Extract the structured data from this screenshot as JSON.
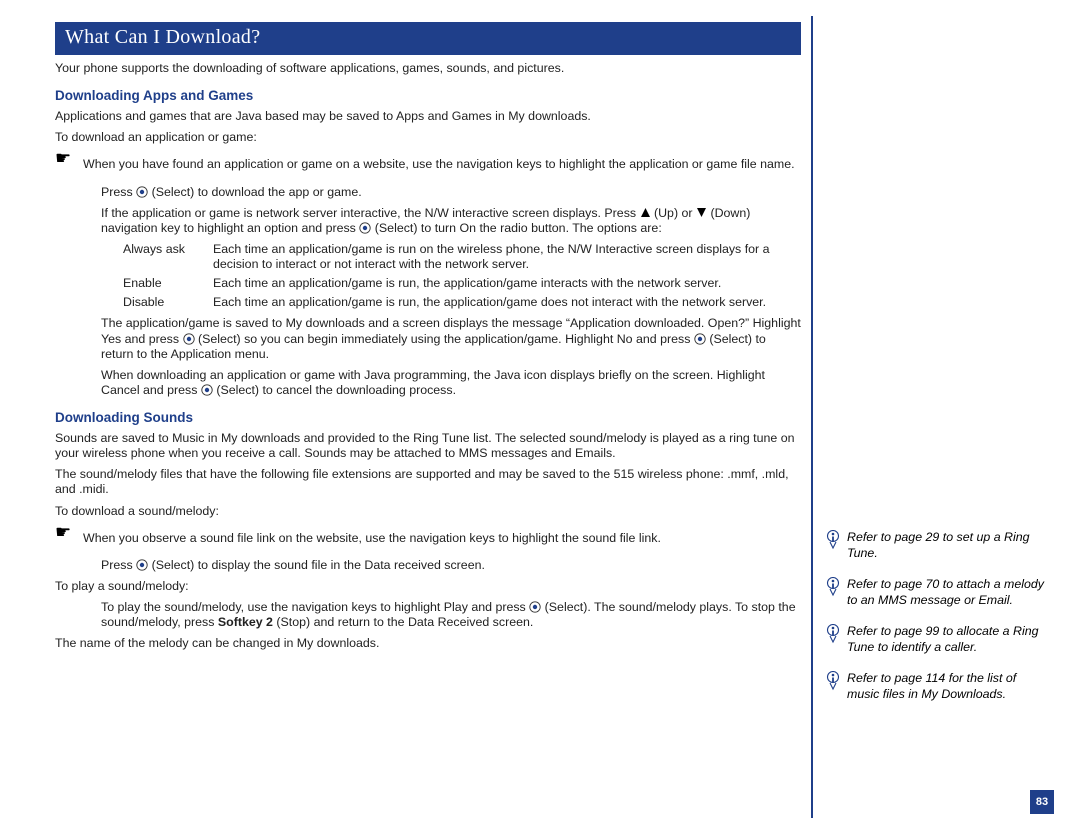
{
  "title": "What Can I Download?",
  "intro": "Your phone supports the downloading of software applications, games, sounds, and pictures.",
  "h_apps": "Downloading Apps and Games",
  "apps_p1": "Applications and games that are Java based may be saved to Apps and Games in My downloads.",
  "apps_p2": "To download an application or game:",
  "apps_b1": "When you have found an application or game on a website, use the navigation keys to highlight the application or game file name.",
  "apps_b1_sub1_a": "Press ",
  "apps_b1_sub1_b": " (Select) to download the app or game.",
  "apps_b1_sub2_a": "If the application or game is network server interactive, the N/W interactive screen displays. Press ",
  "apps_b1_sub2_b": " (Up) or ",
  "apps_b1_sub2_c": " (Down) navigation key to highlight an option and press ",
  "apps_b1_sub2_d": " (Select) to turn On the radio button. The options are:",
  "opt1_l": "Always ask",
  "opt1_d": "Each time an application/game is run on the wireless phone, the N/W Interactive screen displays for a decision to interact or not interact with the network server.",
  "opt2_l": "Enable",
  "opt2_d": "Each time an application/game is run, the application/game interacts with the network server.",
  "opt3_l": "Disable",
  "opt3_d": "Each time an application/game is run, the application/game does not interact with the network server.",
  "apps_b1_sub3_a": "The application/game is saved to My downloads and a screen displays the message “Application downloaded. Open?” Highlight Yes and press ",
  "apps_b1_sub3_b": " (Select) so you can begin immediately using the application/game. Highlight No and press ",
  "apps_b1_sub3_c": " (Select) to return to the Application menu.",
  "apps_b1_sub4_a": "When downloading an application or game with Java programming, the Java icon displays briefly on the screen. Highlight Cancel and press ",
  "apps_b1_sub4_b": " (Select) to cancel the downloading process.",
  "h_sounds": "Downloading Sounds",
  "snd_p1": "Sounds are saved to Music in My downloads and provided to the Ring Tune list. The selected sound/melody is played as a ring tune on your wireless phone when you receive a call. Sounds may be attached to MMS messages and Emails.",
  "snd_p2": "The sound/melody files that have the following file extensions are supported and may be saved to the 515 wireless phone: .mmf, .mld, and .midi.",
  "snd_p3": "To download a sound/melody:",
  "snd_b1": "When you observe a sound file link on the website, use the navigation keys to highlight the sound file link.",
  "snd_b1_sub1_a": "Press ",
  "snd_b1_sub1_b": " (Select) to display the sound file in the Data received screen.",
  "snd_p4": "To play a sound/melody:",
  "snd_p4_sub_a": "To play the sound/melody, use the navigation keys to highlight Play and press ",
  "snd_p4_sub_b": " (Select). The sound/melody plays. To stop the sound/melody, press ",
  "snd_softkey": "Softkey 2",
  "snd_p4_sub_c": " (Stop) and return to the Data Received screen.",
  "snd_p5": "The name of the melody can be changed in My downloads.",
  "note1": "Refer to page 29 to set up a Ring Tune.",
  "note2": "Refer to page 70 to attach a melody to an MMS message or Email.",
  "note3": "Refer to page 99 to allocate a Ring Tune to identify a caller.",
  "note4": "Refer to page 114 for the list of music files in My Downloads.",
  "pagenum": "83"
}
